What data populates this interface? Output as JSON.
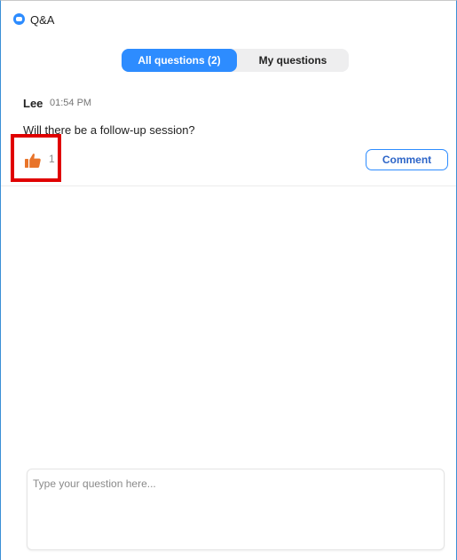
{
  "window": {
    "title": "Q&A"
  },
  "tabs": [
    {
      "label": "All questions (2)",
      "active": true
    },
    {
      "label": "My questions",
      "active": false
    }
  ],
  "questions": [
    {
      "author": "Lee",
      "time": "01:54 PM",
      "text": "Will there be a follow-up session?",
      "likes": "1",
      "comment_label": "Comment",
      "highlighted": true
    }
  ],
  "input": {
    "placeholder": "Type your question here...",
    "value": ""
  },
  "colors": {
    "accent": "#2d8cff",
    "like_icon": "#e8742a",
    "highlight": "#e00000",
    "window_border": "#3a8fd6"
  },
  "icons": {
    "app": "zoom-camera-icon",
    "like": "thumbs-up-icon"
  }
}
